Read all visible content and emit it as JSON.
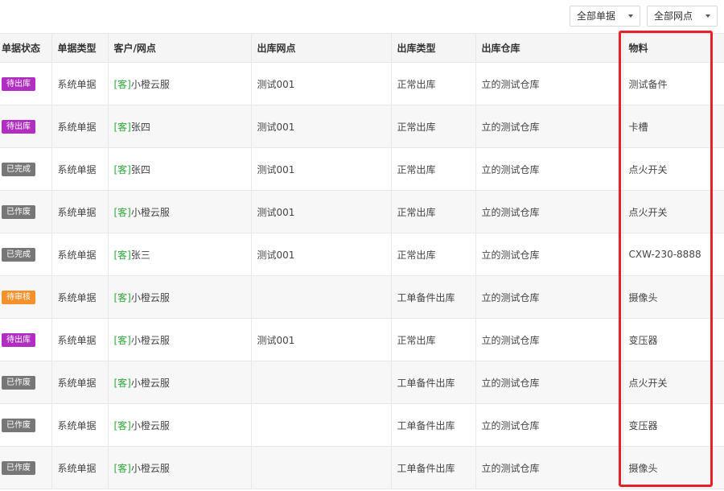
{
  "filters": {
    "doc_type": "全部单据",
    "network": "全部网点"
  },
  "columns": [
    "单据状态",
    "单据类型",
    "客户/网点",
    "出库网点",
    "出库类型",
    "出库仓库",
    "物料"
  ],
  "status_colors": {
    "待出库": "#b02fc1",
    "已完成": "#777777",
    "已作废": "#777777",
    "待审核": "#f5902b"
  },
  "rows": [
    {
      "status": "待出库",
      "doc_type": "系统单据",
      "tag": "[客]",
      "customer": "小橙云服",
      "out_point": "测试001",
      "out_type": "正常出库",
      "warehouse": "立的测试仓库",
      "material": "测试备件"
    },
    {
      "status": "待出库",
      "doc_type": "系统单据",
      "tag": "[客]",
      "customer": "张四",
      "out_point": "测试001",
      "out_type": "正常出库",
      "warehouse": "立的测试仓库",
      "material": "卡槽"
    },
    {
      "status": "已完成",
      "doc_type": "系统单据",
      "tag": "[客]",
      "customer": "张四",
      "out_point": "测试001",
      "out_type": "正常出库",
      "warehouse": "立的测试仓库",
      "material": "点火开关"
    },
    {
      "status": "已作废",
      "doc_type": "系统单据",
      "tag": "[客]",
      "customer": "小橙云服",
      "out_point": "测试001",
      "out_type": "正常出库",
      "warehouse": "立的测试仓库",
      "material": "点火开关"
    },
    {
      "status": "已完成",
      "doc_type": "系统单据",
      "tag": "[客]",
      "customer": "张三",
      "out_point": "测试001",
      "out_type": "正常出库",
      "warehouse": "立的测试仓库",
      "material": "CXW-230-8888"
    },
    {
      "status": "待审核",
      "doc_type": "系统单据",
      "tag": "[客]",
      "customer": "小橙云服",
      "out_point": "",
      "out_type": "工单备件出库",
      "warehouse": "立的测试仓库",
      "material": "摄像头"
    },
    {
      "status": "待出库",
      "doc_type": "系统单据",
      "tag": "[客]",
      "customer": "小橙云服",
      "out_point": "测试001",
      "out_type": "正常出库",
      "warehouse": "立的测试仓库",
      "material": "变压器"
    },
    {
      "status": "已作废",
      "doc_type": "系统单据",
      "tag": "[客]",
      "customer": "小橙云服",
      "out_point": "",
      "out_type": "工单备件出库",
      "warehouse": "立的测试仓库",
      "material": "点火开关"
    },
    {
      "status": "已作废",
      "doc_type": "系统单据",
      "tag": "[客]",
      "customer": "小橙云服",
      "out_point": "",
      "out_type": "工单备件出库",
      "warehouse": "立的测试仓库",
      "material": "变压器"
    },
    {
      "status": "已作废",
      "doc_type": "系统单据",
      "tag": "[客]",
      "customer": "小橙云服",
      "out_point": "",
      "out_type": "工单备件出库",
      "warehouse": "立的测试仓库",
      "material": "摄像头"
    }
  ]
}
